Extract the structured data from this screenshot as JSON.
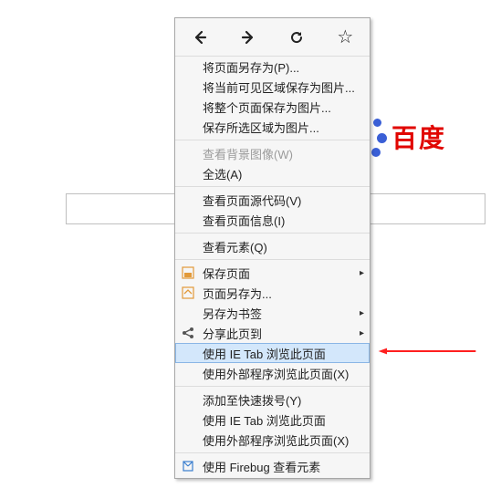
{
  "logo": {
    "text": "百度"
  },
  "topIcons": {
    "back": "←",
    "forward": "→",
    "reload": "↻",
    "bookmark": "☆"
  },
  "menu": {
    "savePageAs": "将页面另存为(P)...",
    "saveVisibleAsImage": "将当前可见区域保存为图片...",
    "saveWholeAsImage": "将整个页面保存为图片...",
    "saveSelectionAsImage": "保存所选区域为图片...",
    "viewBgImage": "查看背景图像(W)",
    "selectAll": "全选(A)",
    "viewSource": "查看页面源代码(V)",
    "viewPageInfo": "查看页面信息(I)",
    "inspectElement": "查看元素(Q)",
    "savePage": "保存页面",
    "pageSaveAs": "页面另存为...",
    "saveAsBookmark": "另存为书签",
    "shareTo": "分享此页到",
    "useIETab": "使用 IE Tab 浏览此页面",
    "useExternal": "使用外部程序浏览此页面(X)",
    "addSpeedDial": "添加至快速拨号(Y)",
    "useIETab2": "使用 IE Tab 浏览此页面",
    "useExternal2": "使用外部程序浏览此页面(X)",
    "useFirebug": "使用 Firebug 查看元素"
  },
  "iconColors": {
    "save": "#e29a3a",
    "saveAs": "#e29a3a",
    "share": "#555",
    "firebug": "#3a7ecf"
  }
}
